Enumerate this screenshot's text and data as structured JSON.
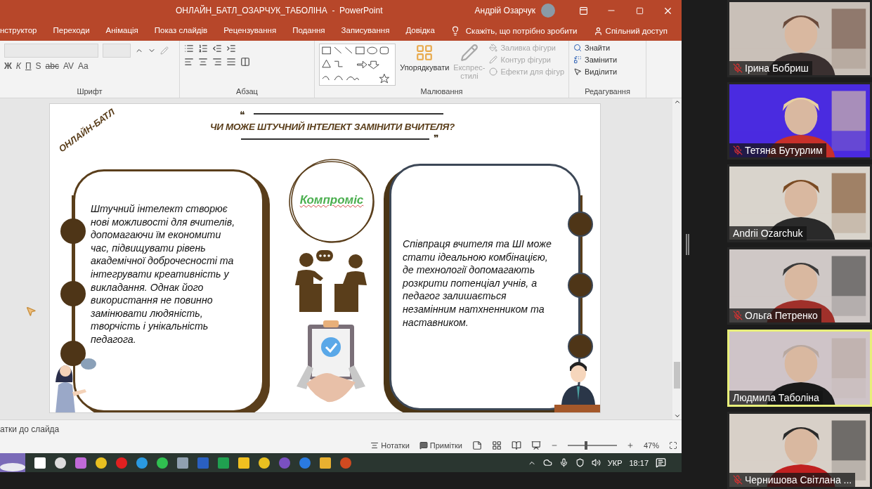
{
  "window": {
    "title": "ОНЛАЙН_БАТЛ_ОЗАРЧУК_ТАБОЛІНА  -  PowerPoint",
    "user": "Андрій Озарчук"
  },
  "ribbon_tabs": [
    {
      "label": "нструктор",
      "selected": false
    },
    {
      "label": "Переходи",
      "selected": false
    },
    {
      "label": "Анімація",
      "selected": false
    },
    {
      "label": "Показ слайдів",
      "selected": false
    },
    {
      "label": "Рецензування",
      "selected": false
    },
    {
      "label": "Подання",
      "selected": false
    },
    {
      "label": "Записування",
      "selected": false
    },
    {
      "label": "Довідка",
      "selected": false
    }
  ],
  "tell_me": {
    "placeholder": "Скажіть, що потрібно зробити"
  },
  "share": "Спільний доступ",
  "font_group": {
    "label": "Шрифт",
    "format_buttons": [
      "Ж",
      "К",
      "П",
      "S",
      "abc",
      "AV",
      "Aa"
    ]
  },
  "paragraph_group": {
    "label": "Абзац"
  },
  "drawing_group": {
    "label": "Малювання",
    "arrange": "Упорядкувати",
    "quick_styles": "Експрес-\nстилі",
    "shape_commands": [
      {
        "label": "Заливка фігури",
        "disabled": true
      },
      {
        "label": "Контур фігури",
        "disabled": true
      },
      {
        "label": "Ефекти для фігур",
        "disabled": true
      }
    ]
  },
  "editing_group": {
    "label": "Редагування",
    "commands": [
      {
        "kind": "find",
        "label": "Знайти"
      },
      {
        "kind": "replace",
        "label": "Замінити"
      },
      {
        "kind": "select",
        "label": "Виділити"
      }
    ]
  },
  "slide": {
    "badge": "ОНЛАЙН-БАТЛ",
    "open_quote": "❝",
    "close_quote": "❞",
    "title": "ЧИ МОЖЕ ШТУЧНИЙ ІНТЕЛЕКТ ЗАМІНИТИ ВЧИТЕЛЯ?",
    "left_text": "Штучний інтелект створює\nнові можливості для вчителів,\nдопомагаючи їм економити\nчас, підвищувати рівень\nакадемічної доброчесності та\nінтегрувати креативність у\nвикладання. Однак його\nвикористання не повинно\nзамінювати людяність,\nтворчість і унікальність\nпедагога.",
    "center_label": "Компроміс",
    "right_text": "Співпраця вчителя та ШІ може\nстати ідеальною комбінацією,\nде технології допомагають\nрозкрити потенціал учнів, а\nпедагог залишається\nнезамінним натхненником та\nнаставником."
  },
  "notes_placeholder": "атки до слайда",
  "status_bar": {
    "notes": "Нотатки",
    "comments": "Примітки",
    "zoom": {
      "label": "47%",
      "level": 0.35
    }
  },
  "taskbar": {
    "language": "УКР",
    "time": "18:17"
  },
  "participants": [
    {
      "name": "Ірина Бобриш",
      "muted": true,
      "speaking": false
    },
    {
      "name": "Тетяна Бутурлим",
      "muted": true,
      "speaking": false
    },
    {
      "name": "Andrii Ozarchuk",
      "muted": false,
      "speaking": false
    },
    {
      "name": "Ольга Петренко",
      "muted": true,
      "speaking": false
    },
    {
      "name": "Людмила Таболіна",
      "muted": false,
      "speaking": true
    },
    {
      "name": "Чернишова Світлана ...",
      "muted": true,
      "speaking": false
    }
  ]
}
